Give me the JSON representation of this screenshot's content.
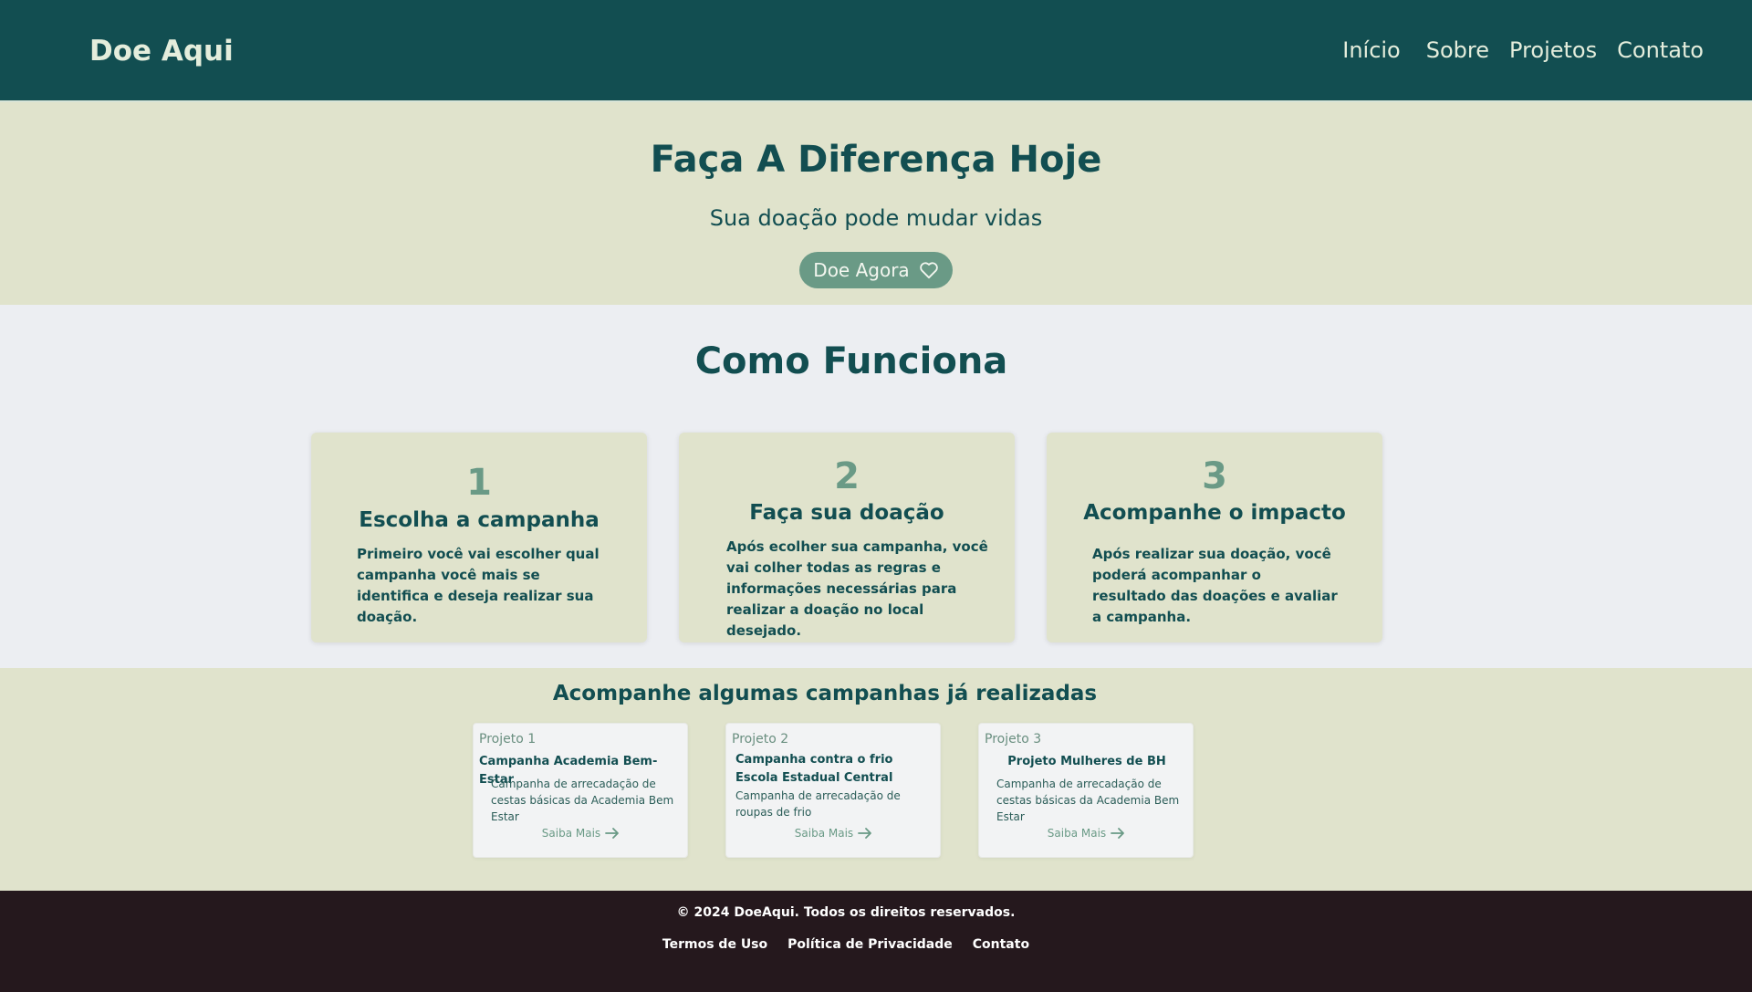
{
  "header": {
    "logo": "Doe Aqui",
    "nav": [
      "Início",
      "Sobre",
      "Projetos",
      "Contato"
    ]
  },
  "hero": {
    "title": "Faça A Diferença Hoje",
    "subtitle": "Sua doação pode mudar vidas",
    "cta_label": "Doe Agora",
    "cta_icon": "heart-icon"
  },
  "how": {
    "title": "Como Funciona",
    "steps": [
      {
        "number": "1",
        "title": "Escolha a campanha",
        "description": "Primeiro você vai escolher qual campanha você mais se identifica e deseja realizar sua doação."
      },
      {
        "number": "2",
        "title": "Faça sua doação",
        "description": "Após ecolher sua campanha, você vai colher todas as regras e informações necessárias para realizar a doação no local desejado."
      },
      {
        "number": "3",
        "title": "Acompanhe o impacto",
        "description": "Após realizar sua doação, você poderá acompanhar o resultado das doações e avaliar a campanha."
      }
    ]
  },
  "campaigns": {
    "title": "Acompanhe algumas campanhas já realizadas",
    "more_label": "Saiba Mais",
    "more_icon": "arrow-right-icon",
    "items": [
      {
        "label": "Projeto 1",
        "title": "Campanha Academia Bem-Estar",
        "description": "Campanha de arrecadação de cestas básicas da Academia Bem Estar"
      },
      {
        "label": "Projeto 2",
        "title": "Campanha contra o frio Escola Estadual Central",
        "description": "Campanha de arrecadação de roupas de frio"
      },
      {
        "label": "Projeto 3",
        "title": "Projeto Mulheres de BH",
        "description": "Campanha de arrecadação de cestas básicas da Academia Bem Estar"
      }
    ]
  },
  "footer": {
    "copyright": "© 2024 DoeAqui. Todos os direitos reservados.",
    "links": [
      "Termos de Uso",
      "Política de Privacidade",
      "Contato"
    ]
  },
  "colors": {
    "header_bg": "#124e51",
    "hero_bg": "#e0e3cc",
    "accent": "#6a9a86",
    "footer_bg": "#25181d"
  }
}
